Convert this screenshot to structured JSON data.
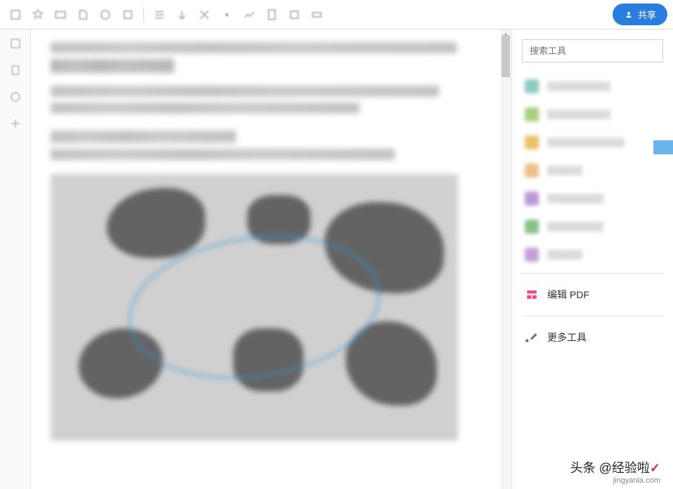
{
  "toolbar": {
    "share_label": "共享"
  },
  "sidebar": {
    "search_placeholder": "搜索工具",
    "tools": [
      {
        "label": "",
        "color": "teal"
      },
      {
        "label": "",
        "color": "green"
      },
      {
        "label": "",
        "color": "yellow"
      },
      {
        "label": "",
        "color": "orange"
      },
      {
        "label": "",
        "color": "purple"
      },
      {
        "label": "",
        "color": "green2"
      },
      {
        "label": "",
        "color": "purple2"
      }
    ],
    "edit_pdf_label": "编辑 PDF",
    "more_tools_label": "更多工具"
  },
  "watermark": {
    "prefix": "头条 @",
    "name": "经验啦",
    "url": "jingyanla.com"
  }
}
